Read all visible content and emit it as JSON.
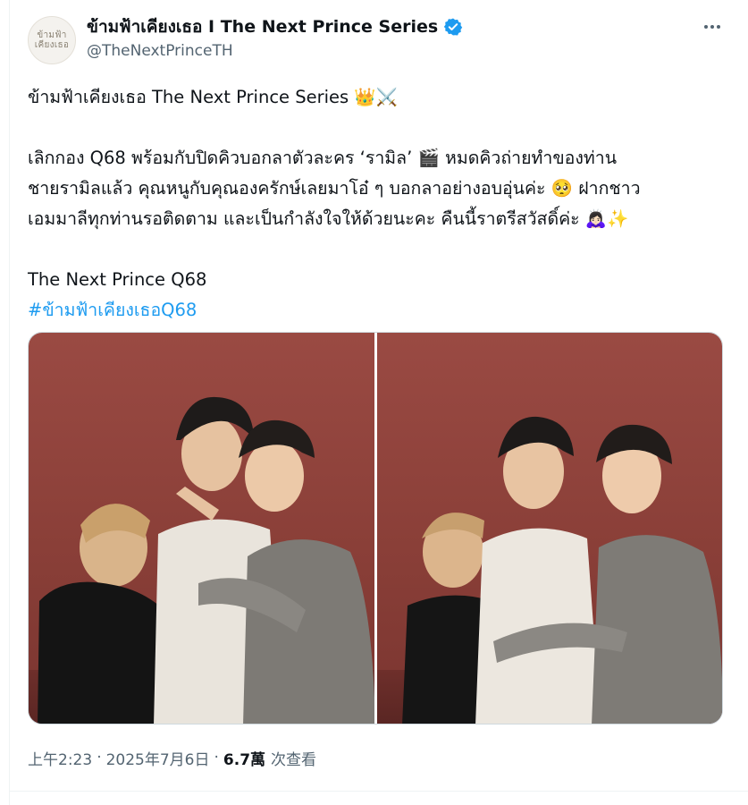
{
  "author": {
    "display_name": "ข้ามฟ้าเคียงเธอ I The Next Prince Series",
    "handle": "@TheNextPrinceTH",
    "avatar_text_line1": "ข้ามฟ้า",
    "avatar_text_line2": "เคียงเธอ",
    "verified": true
  },
  "tweet": {
    "line1_text": "ข้ามฟ้าเคียงเธอ The Next Prince Series ",
    "line1_emoji": "👑⚔️",
    "line2_text_a": "เลิกกอง Q68 พร้อมกับปิดคิวบอกลาตัวละคร ‘รามิล’ ",
    "line2_emoji": "🎬",
    "line2_text_b": " หมดคิวถ่ายทำของท่าน",
    "line3_text_a": "ชายรามิลแล้ว คุณหนูกับคุณองครักษ์เลยมาโอ๋ ๆ บอกลาอย่างอบอุ่นค่ะ ",
    "line3_emoji": "🥺",
    "line3_text_b": " ฝากชาว",
    "line4_text": "เอมมาลีทุกท่านรอติดตาม และเป็นกำลังใจให้ด้วยนะคะ คืนนี้ราตรีสวัสดิ์ค่ะ ",
    "line4_emoji": "🙇🏻‍♀️✨",
    "line5_text": "The Next Prince Q68",
    "hashtag": "#ข้ามฟ้าเคียงเธอQ68"
  },
  "media": {
    "photo_count": 2,
    "background_color": "#8f443d"
  },
  "meta": {
    "time": "上午2:23",
    "separator": "·",
    "date": "2025年7月6日",
    "views_count": "6.7萬",
    "views_label": "次查看"
  },
  "colors": {
    "accent": "#1d9bf0",
    "text_primary": "#0f1419",
    "text_secondary": "#536471"
  },
  "icons": {
    "verified": "verified-badge-icon",
    "more": "more-options-icon"
  }
}
